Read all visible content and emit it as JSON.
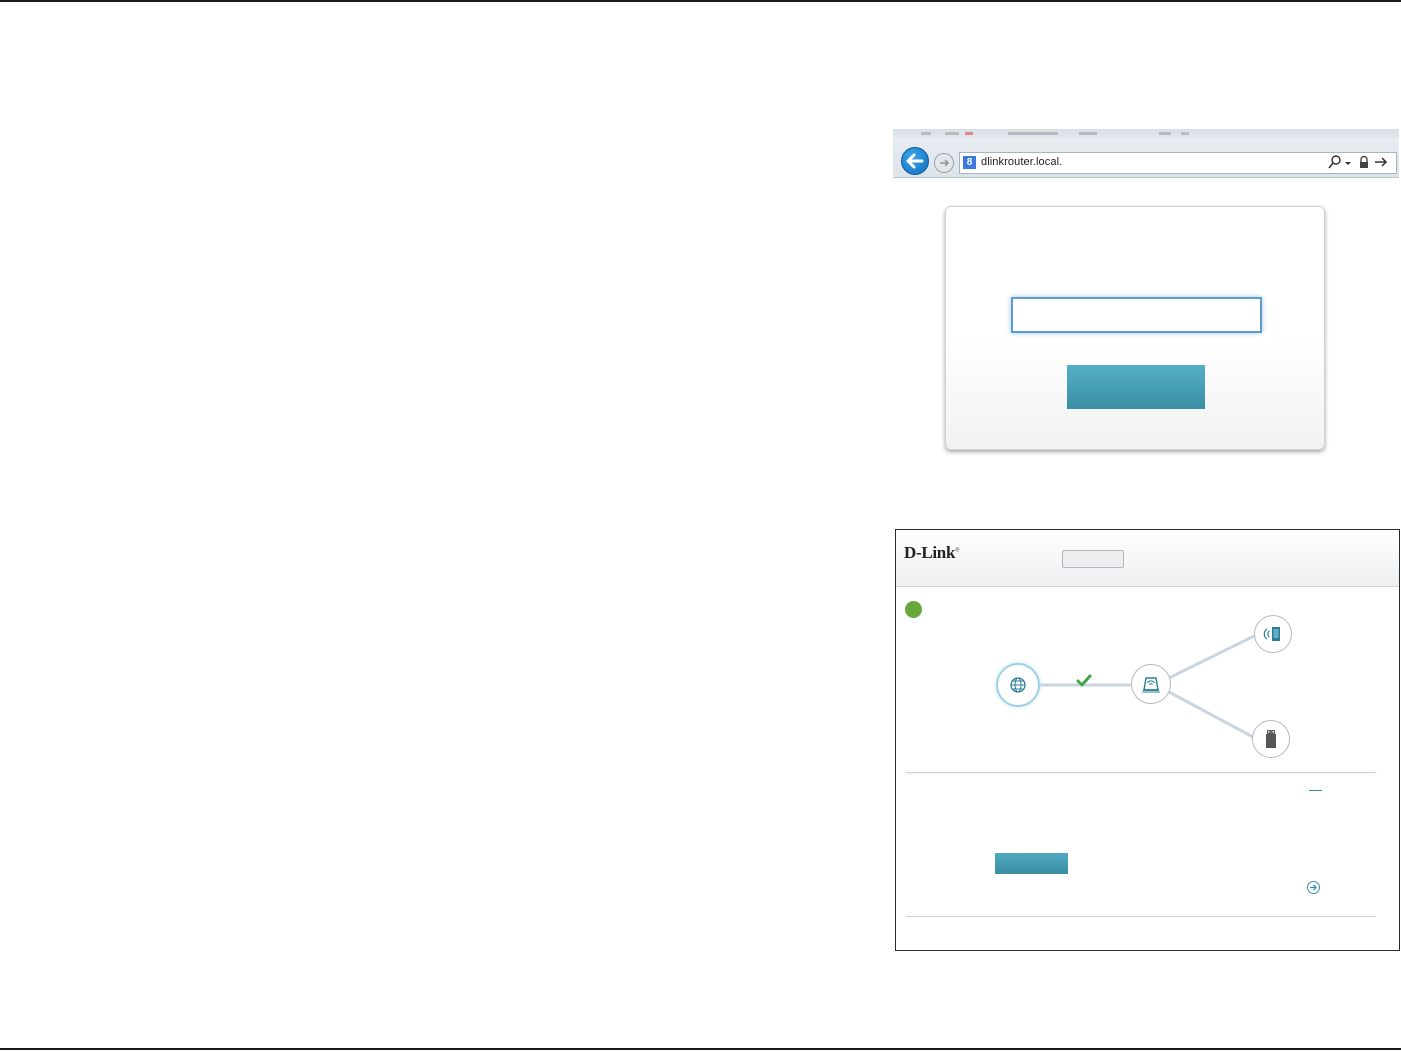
{
  "browser": {
    "address_url": "dlinkrouter.local.",
    "favicon_letter": "8",
    "icons": [
      "back-arrow-icon",
      "forward-arrow-icon",
      "search-icon",
      "dropdown-icon",
      "lock-icon",
      "go-arrow-icon"
    ]
  },
  "login_card": {
    "password_value": "",
    "login_button_label": ""
  },
  "dashboard": {
    "logo_text": "D-Link",
    "logo_mark": "®",
    "header_tab_label": "",
    "status_color": "#68a83a",
    "network_nodes": [
      "globe-icon",
      "router-icon",
      "mobile-device-icon",
      "usb-device-icon"
    ],
    "connection_status_icon": "checkmark-icon",
    "button_label": ""
  },
  "colors": {
    "accent": "#3b8fa4",
    "status_ok": "#68a83a",
    "browser_back": "#1e7fd0"
  }
}
